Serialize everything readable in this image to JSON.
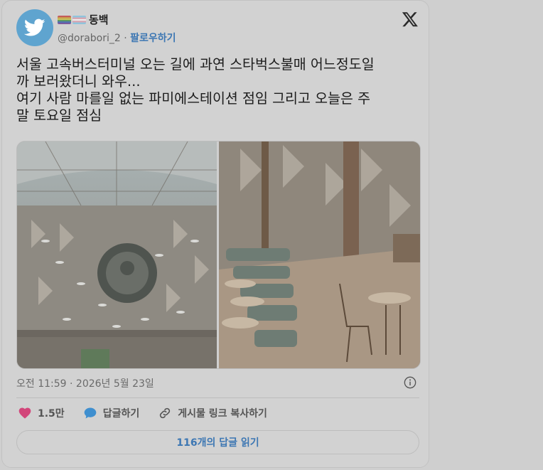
{
  "author": {
    "display_name": "동백",
    "handle": "@dorabori_2",
    "separator": " · ",
    "follow_label": "팔로우하기"
  },
  "tweet": {
    "text": "서울 고속버스터미널 오는 길에 과연 스타벅스불매 어느정도일\n까 보러왔더니 와우...\n여기 사람 마를일 없는 파미에스테이션 점임 그리고 오늘은 주\n말 토요일 점심",
    "timestamp": "오전 11:59 · 2026년 5월 23일"
  },
  "actions": {
    "likes": "1.5만",
    "reply_label": "답글하기",
    "copy_link_label": "게시물 링크 복사하기"
  },
  "read_replies_label": "116개의 답글 읽기",
  "colors": {
    "link": "#3d77b3",
    "heart": "#d2467a",
    "reply_bubble": "#3f8fcf",
    "avatar_bg": "#5fa4cf"
  },
  "icons": [
    "twitter-bird-icon",
    "x-logo-icon",
    "info-icon",
    "heart-icon",
    "reply-bubble-icon",
    "link-icon"
  ]
}
